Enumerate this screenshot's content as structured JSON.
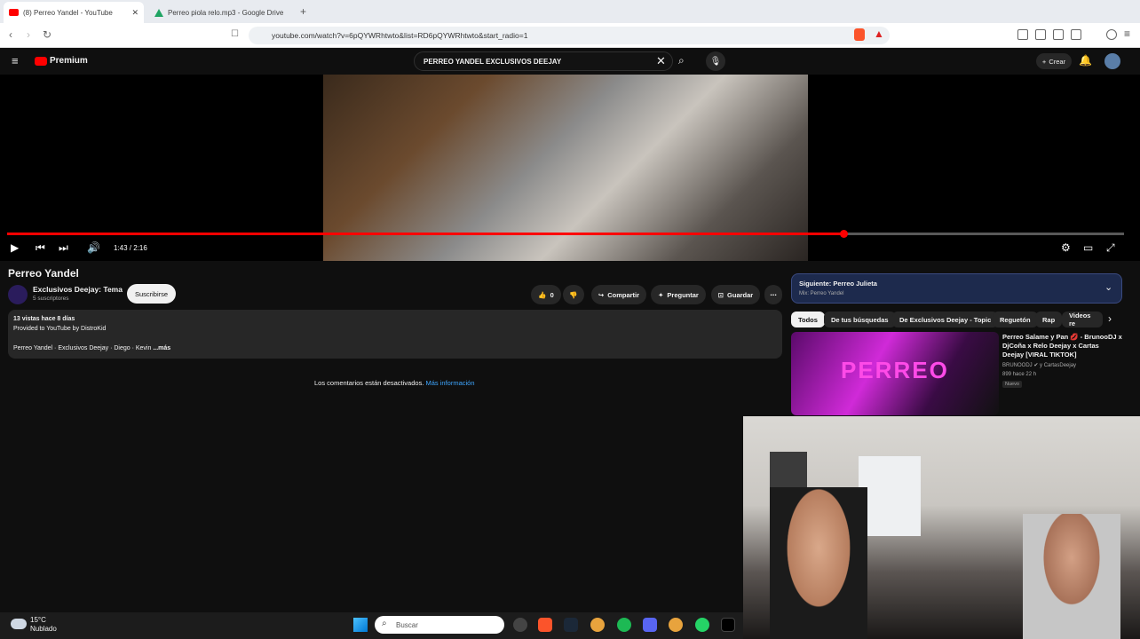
{
  "browser": {
    "tabs": [
      {
        "title": "(8) Perreo Yandel - YouTube",
        "active": true
      },
      {
        "title": "Perreo piola relo.mp3 - Google Drive",
        "active": false
      }
    ],
    "url": "youtube.com/watch?v=6pQYWRhtwto&list=RD6pQYWRhtwto&start_radio=1"
  },
  "youtube": {
    "logo": "Premium",
    "search_query": "PERREO YANDEL EXCLUSIVOS DEEJAY",
    "create_label": "Crear",
    "player": {
      "time": "1:43 / 2:16",
      "progress_fraction": 0.75
    },
    "video": {
      "title": "Perreo Yandel",
      "channel": "Exclusivos Deejay: Tema",
      "subscribers": "5 suscriptores",
      "subscribe_label": "Suscribirse",
      "likes": "0",
      "share_label": "Compartir",
      "ask_label": "Preguntar",
      "save_label": "Guardar",
      "views_date": "13 vistas  hace 8 días",
      "provided": "Provided to YouTube by DistroKid",
      "desc_line": "Perreo Yandel · Exclusivos Deejay · Diego · Kevin",
      "more": "...más"
    },
    "comments_off": "Los comentarios están desactivados.",
    "more_info": "Más información",
    "next_up": {
      "label": "Siguiente: Perreo Julieta",
      "sub": "Mix: Perreo Yandel"
    },
    "chips": [
      "Todos",
      "De tus búsquedas",
      "De Exclusivos Deejay - Topic",
      "Reguetón",
      "Rap",
      "Videos re"
    ],
    "recommended": {
      "title": "Perreo Salame y Pan 💋 - BrunooDJ x DjCoña x Relo Deejay x Cartas Deejay [VIRAL TIKTOK]",
      "channel": "BRUNOODJ ✔ y CartasDeejay",
      "meta": "899  hace 22 h",
      "badge": "Nuevo",
      "thumb_text": "PERREO"
    }
  },
  "taskbar": {
    "temp": "15°C",
    "weather": "Nublado",
    "search_placeholder": "Buscar"
  },
  "colors": {
    "accent": "#ff0000",
    "link": "#3ea6ff"
  }
}
